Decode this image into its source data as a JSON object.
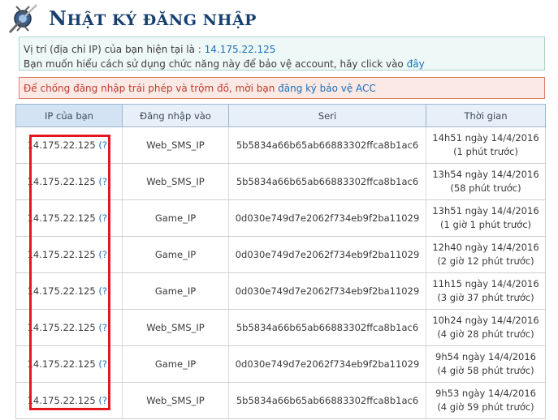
{
  "page": {
    "title_first": "N",
    "title_rest": "HẬT KÝ ĐĂNG NHẬP"
  },
  "info": {
    "ip_prefix": "Vị trí (địa chỉ IP) của bạn hiện tại là : ",
    "current_ip": "14.175.22.125",
    "help_text": "Bạn muốn hiểu cách sử dụng chức năng này để bảo vệ account, hãy click vào ",
    "help_link": "đây"
  },
  "warning": {
    "text": "Để chống đăng nhập trái phép và trộm đồ, mời bạn ",
    "link": "đăng ký bảo vệ ACC"
  },
  "table": {
    "headers": [
      "IP của bạn",
      "Đăng nhập vào",
      "Seri",
      "Thời gian"
    ],
    "rows": [
      {
        "ip": "14.175.22.125",
        "q": "(?)",
        "target": "Web_SMS_IP",
        "seri": "5b5834a66b65ab66883302ffca8b1ac6",
        "time": "14h51 ngày 14/4/2016",
        "ago": "(1 phút trước)"
      },
      {
        "ip": "14.175.22.125",
        "q": "(?)",
        "target": "Web_SMS_IP",
        "seri": "5b5834a66b65ab66883302ffca8b1ac6",
        "time": "13h54 ngày 14/4/2016",
        "ago": "(58 phút trước)"
      },
      {
        "ip": "14.175.22.125",
        "q": "(?)",
        "target": "Game_IP",
        "seri": "0d030e749d7e2062f734eb9f2ba11029",
        "time": "13h51 ngày 14/4/2016",
        "ago": "(1 giờ 1 phút trước)"
      },
      {
        "ip": "14.175.22.125",
        "q": "(?)",
        "target": "Game_IP",
        "seri": "0d030e749d7e2062f734eb9f2ba11029",
        "time": "12h40 ngày 14/4/2016",
        "ago": "(2 giờ 12 phút trước)"
      },
      {
        "ip": "14.175.22.125",
        "q": "(?)",
        "target": "Game_IP",
        "seri": "0d030e749d7e2062f734eb9f2ba11029",
        "time": "11h15 ngày 14/4/2016",
        "ago": "(3 giờ 37 phút trước)"
      },
      {
        "ip": "14.175.22.125",
        "q": "(?)",
        "target": "Web_SMS_IP",
        "seri": "5b5834a66b65ab66883302ffca8b1ac6",
        "time": "10h24 ngày 14/4/2016",
        "ago": "(4 giờ 28 phút trước)"
      },
      {
        "ip": "14.175.22.125",
        "q": "(?)",
        "target": "Game_IP",
        "seri": "0d030e749d7e2062f734eb9f2ba11029",
        "time": "9h54 ngày 14/4/2016",
        "ago": "(4 giờ 58 phút trước)"
      },
      {
        "ip": "14.175.22.125",
        "q": "(?)",
        "target": "Web_SMS_IP",
        "seri": "5b5834a66b65ab66883302ffca8b1ac6",
        "time": "9h53 ngày 14/4/2016",
        "ago": "(4 giờ 59 phút trước)"
      }
    ]
  },
  "colors": {
    "title": "#17406f",
    "link": "#1a6fb8",
    "warning_text": "#c03a2b",
    "highlight_border": "#e2171f"
  },
  "icons": {
    "logo": "sword-emblem-icon"
  }
}
